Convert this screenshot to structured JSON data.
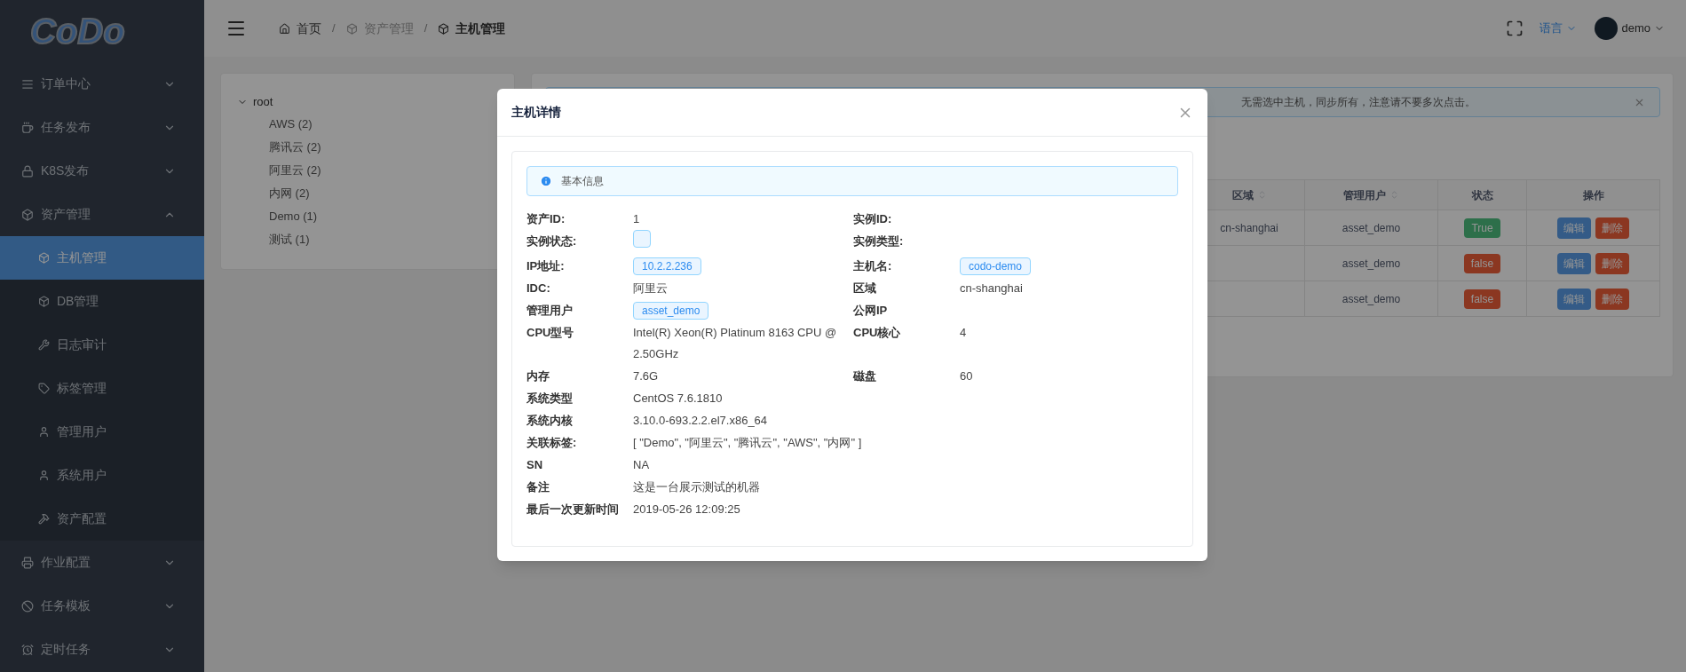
{
  "logo": "CoDo",
  "sidebar": {
    "items": [
      {
        "label": "订单中心",
        "expanded": false,
        "selected": false
      },
      {
        "label": "任务发布",
        "expanded": false,
        "selected": false
      },
      {
        "label": "K8S发布",
        "expanded": false,
        "selected": false
      },
      {
        "label": "资产管理",
        "expanded": true,
        "selected": false,
        "children": [
          {
            "label": "主机管理",
            "selected": true
          },
          {
            "label": "DB管理",
            "selected": false
          },
          {
            "label": "日志审计",
            "selected": false
          },
          {
            "label": "标签管理",
            "selected": false
          },
          {
            "label": "管理用户",
            "selected": false
          },
          {
            "label": "系统用户",
            "selected": false
          },
          {
            "label": "资产配置",
            "selected": false
          }
        ]
      },
      {
        "label": "作业配置",
        "expanded": false,
        "selected": false
      },
      {
        "label": "任务模板",
        "expanded": false,
        "selected": false
      },
      {
        "label": "定时任务",
        "expanded": false,
        "selected": false
      }
    ]
  },
  "header": {
    "breadcrumbs": [
      {
        "label": "首页",
        "current": false
      },
      {
        "label": "资产管理",
        "current": false
      },
      {
        "label": "主机管理",
        "current": true
      }
    ],
    "separator": "/",
    "language": "语言",
    "user": "demo"
  },
  "tree": {
    "label": "root",
    "expanded": true,
    "children": [
      {
        "label": "AWS (2)"
      },
      {
        "label": "腾讯云 (2)"
      },
      {
        "label": "阿里云 (2)"
      },
      {
        "label": "内网 (2)"
      },
      {
        "label": "Demo (1)"
      },
      {
        "label": "测试 (1)"
      }
    ]
  },
  "alert": {
    "text": "无需选中主机，同步所有，注意请不要多次点击。"
  },
  "table": {
    "columns": [
      {
        "label": "区域",
        "sortable": true
      },
      {
        "label": "管理用户",
        "sortable": true
      },
      {
        "label": "状态",
        "sortable": false
      },
      {
        "label": "操作",
        "sortable": false
      }
    ],
    "rows": [
      {
        "region": "cn-shanghai",
        "user": "asset_demo",
        "status": {
          "label": "True",
          "kind": "success"
        },
        "actions": [
          "编辑",
          "删除"
        ]
      },
      {
        "user": "asset_demo",
        "status": {
          "label": "false",
          "kind": "error"
        },
        "actions": [
          "编辑",
          "删除"
        ]
      },
      {
        "user": "asset_demo",
        "status": {
          "label": "false",
          "kind": "error"
        },
        "actions": [
          "编辑",
          "删除"
        ]
      }
    ]
  },
  "modal": {
    "title": "主机详情",
    "section": "基本信息",
    "rows": [
      {
        "left": {
          "label": "资产ID:",
          "value": "1",
          "kind": "text"
        },
        "right": {
          "label": "实例ID:",
          "kind": "text"
        }
      },
      {
        "left": {
          "label": "实例状态:",
          "kind": "tag"
        },
        "right": {
          "label": "实例类型:",
          "kind": "text"
        }
      },
      {
        "left": {
          "label": "IP地址:",
          "value": "10.2.2.236",
          "kind": "tag"
        },
        "right": {
          "label": "主机名:",
          "value": "codo-demo",
          "kind": "tag"
        }
      },
      {
        "left": {
          "label": "IDC:",
          "value": "阿里云",
          "kind": "text"
        },
        "right": {
          "label": "区域",
          "value": "cn-shanghai",
          "kind": "text"
        }
      },
      {
        "left": {
          "label": "管理用户",
          "value": "asset_demo",
          "kind": "tag"
        },
        "right": {
          "label": "公网IP",
          "kind": "text"
        }
      },
      {
        "left": {
          "label": "CPU型号",
          "value": "Intel(R) Xeon(R) Platinum 8163 CPU @ 2.50GHz",
          "kind": "text"
        },
        "right": {
          "label": "CPU核心",
          "value": "4",
          "kind": "text"
        }
      },
      {
        "left": {
          "label": "内存",
          "value": "7.6G",
          "kind": "text"
        },
        "right": {
          "label": "磁盘",
          "value": "60",
          "kind": "text"
        }
      },
      {
        "left": {
          "label": "系统类型",
          "value": "CentOS 7.6.1810",
          "kind": "text"
        }
      },
      {
        "left": {
          "label": "系统内核",
          "value": "3.10.0-693.2.2.el7.x86_64",
          "kind": "text"
        }
      },
      {
        "left": {
          "label": "关联标签:",
          "value": "[ \"Demo\", \"阿里云\", \"腾讯云\", \"AWS\", \"内网\" ]",
          "kind": "text"
        }
      },
      {
        "left": {
          "label": "SN",
          "value": "NA",
          "kind": "text"
        }
      },
      {
        "left": {
          "label": "备注",
          "value": "这是一台展示测试的机器",
          "kind": "text"
        }
      },
      {
        "left": {
          "label": "最后一次更新时间",
          "value": "2019-05-26 12:09:25",
          "kind": "text"
        }
      }
    ]
  }
}
